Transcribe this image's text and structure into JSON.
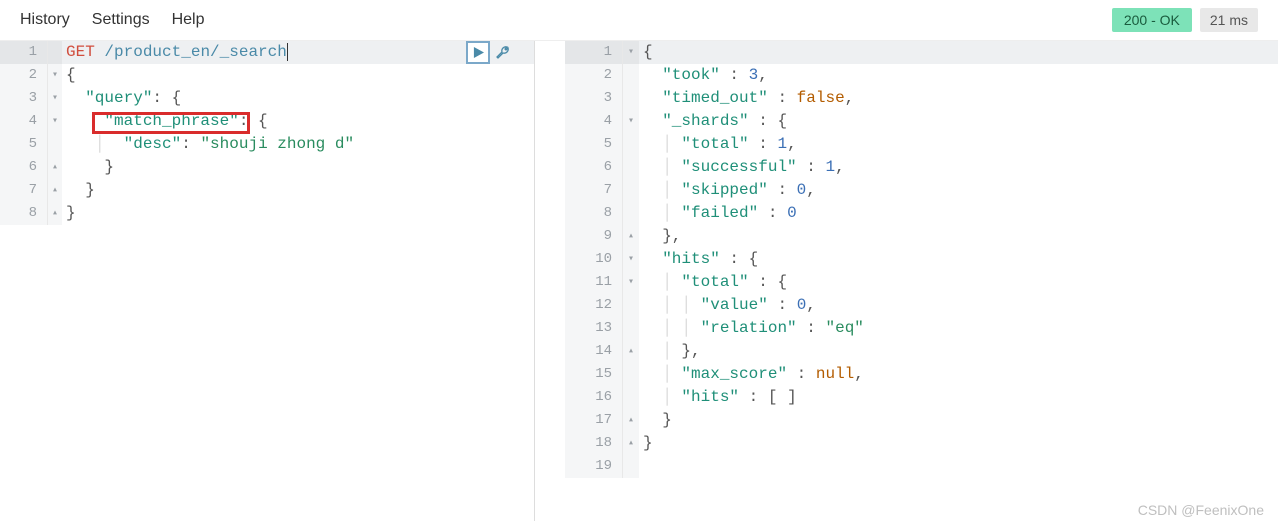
{
  "menubar": {
    "history": "History",
    "settings": "Settings",
    "help": "Help"
  },
  "status": {
    "code": "200 - OK",
    "time": "21 ms"
  },
  "request": {
    "method": "GET",
    "path": "/product_en/_search",
    "lines": [
      {
        "n": "1",
        "fold": "",
        "hl": true
      },
      {
        "n": "2",
        "fold": "▾",
        "hl": false
      },
      {
        "n": "3",
        "fold": "▾",
        "hl": false
      },
      {
        "n": "4",
        "fold": "▾",
        "hl": false
      },
      {
        "n": "5",
        "fold": "",
        "hl": false
      },
      {
        "n": "6",
        "fold": "▴",
        "hl": false
      },
      {
        "n": "7",
        "fold": "▴",
        "hl": false
      },
      {
        "n": "8",
        "fold": "▴",
        "hl": false
      }
    ],
    "body": {
      "query_key": "\"query\"",
      "match_phrase_key": "\"match_phrase\"",
      "desc_key": "\"desc\"",
      "desc_val": "\"shouji zhong d\""
    }
  },
  "response": {
    "lines": [
      {
        "n": "1",
        "fold": "▾",
        "hl": true
      },
      {
        "n": "2",
        "fold": "",
        "hl": false
      },
      {
        "n": "3",
        "fold": "",
        "hl": false
      },
      {
        "n": "4",
        "fold": "▾",
        "hl": false
      },
      {
        "n": "5",
        "fold": "",
        "hl": false
      },
      {
        "n": "6",
        "fold": "",
        "hl": false
      },
      {
        "n": "7",
        "fold": "",
        "hl": false
      },
      {
        "n": "8",
        "fold": "",
        "hl": false
      },
      {
        "n": "9",
        "fold": "▴",
        "hl": false
      },
      {
        "n": "10",
        "fold": "▾",
        "hl": false
      },
      {
        "n": "11",
        "fold": "▾",
        "hl": false
      },
      {
        "n": "12",
        "fold": "",
        "hl": false
      },
      {
        "n": "13",
        "fold": "",
        "hl": false
      },
      {
        "n": "14",
        "fold": "▴",
        "hl": false
      },
      {
        "n": "15",
        "fold": "",
        "hl": false
      },
      {
        "n": "16",
        "fold": "",
        "hl": false
      },
      {
        "n": "17",
        "fold": "▴",
        "hl": false
      },
      {
        "n": "18",
        "fold": "▴",
        "hl": false
      },
      {
        "n": "19",
        "fold": "",
        "hl": false
      }
    ],
    "keys": {
      "took": "\"took\"",
      "timed_out": "\"timed_out\"",
      "shards": "\"_shards\"",
      "total": "\"total\"",
      "successful": "\"successful\"",
      "skipped": "\"skipped\"",
      "failed": "\"failed\"",
      "hits": "\"hits\"",
      "value": "\"value\"",
      "relation": "\"relation\"",
      "max_score": "\"max_score\""
    },
    "vals": {
      "took": "3",
      "timed_out": "false",
      "total_shards": "1",
      "successful": "1",
      "skipped": "0",
      "failed": "0",
      "value": "0",
      "relation": "\"eq\"",
      "max_score": "null",
      "hits_arr": "[ ]"
    }
  },
  "watermark": "CSDN @FeenixOne"
}
